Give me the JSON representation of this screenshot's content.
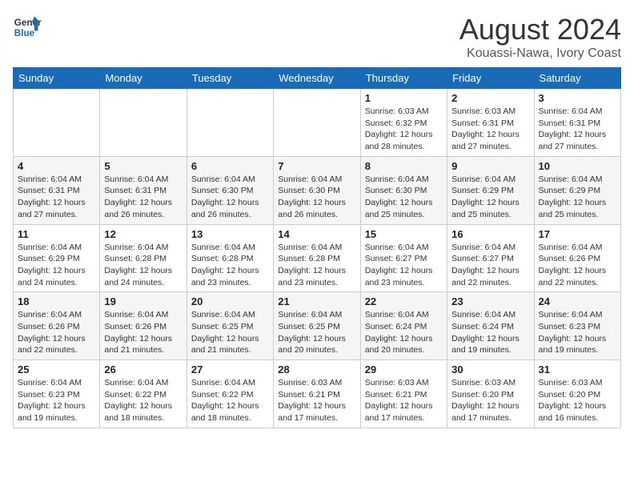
{
  "header": {
    "logo_line1": "General",
    "logo_line2": "Blue",
    "title": "August 2024",
    "subtitle": "Kouassi-Nawa, Ivory Coast"
  },
  "weekdays": [
    "Sunday",
    "Monday",
    "Tuesday",
    "Wednesday",
    "Thursday",
    "Friday",
    "Saturday"
  ],
  "weeks": [
    [
      {
        "day": "",
        "info": ""
      },
      {
        "day": "",
        "info": ""
      },
      {
        "day": "",
        "info": ""
      },
      {
        "day": "",
        "info": ""
      },
      {
        "day": "1",
        "info": "Sunrise: 6:03 AM\nSunset: 6:32 PM\nDaylight: 12 hours\nand 28 minutes."
      },
      {
        "day": "2",
        "info": "Sunrise: 6:03 AM\nSunset: 6:31 PM\nDaylight: 12 hours\nand 27 minutes."
      },
      {
        "day": "3",
        "info": "Sunrise: 6:04 AM\nSunset: 6:31 PM\nDaylight: 12 hours\nand 27 minutes."
      }
    ],
    [
      {
        "day": "4",
        "info": "Sunrise: 6:04 AM\nSunset: 6:31 PM\nDaylight: 12 hours\nand 27 minutes."
      },
      {
        "day": "5",
        "info": "Sunrise: 6:04 AM\nSunset: 6:31 PM\nDaylight: 12 hours\nand 26 minutes."
      },
      {
        "day": "6",
        "info": "Sunrise: 6:04 AM\nSunset: 6:30 PM\nDaylight: 12 hours\nand 26 minutes."
      },
      {
        "day": "7",
        "info": "Sunrise: 6:04 AM\nSunset: 6:30 PM\nDaylight: 12 hours\nand 26 minutes."
      },
      {
        "day": "8",
        "info": "Sunrise: 6:04 AM\nSunset: 6:30 PM\nDaylight: 12 hours\nand 25 minutes."
      },
      {
        "day": "9",
        "info": "Sunrise: 6:04 AM\nSunset: 6:29 PM\nDaylight: 12 hours\nand 25 minutes."
      },
      {
        "day": "10",
        "info": "Sunrise: 6:04 AM\nSunset: 6:29 PM\nDaylight: 12 hours\nand 25 minutes."
      }
    ],
    [
      {
        "day": "11",
        "info": "Sunrise: 6:04 AM\nSunset: 6:29 PM\nDaylight: 12 hours\nand 24 minutes."
      },
      {
        "day": "12",
        "info": "Sunrise: 6:04 AM\nSunset: 6:28 PM\nDaylight: 12 hours\nand 24 minutes."
      },
      {
        "day": "13",
        "info": "Sunrise: 6:04 AM\nSunset: 6:28 PM\nDaylight: 12 hours\nand 23 minutes."
      },
      {
        "day": "14",
        "info": "Sunrise: 6:04 AM\nSunset: 6:28 PM\nDaylight: 12 hours\nand 23 minutes."
      },
      {
        "day": "15",
        "info": "Sunrise: 6:04 AM\nSunset: 6:27 PM\nDaylight: 12 hours\nand 23 minutes."
      },
      {
        "day": "16",
        "info": "Sunrise: 6:04 AM\nSunset: 6:27 PM\nDaylight: 12 hours\nand 22 minutes."
      },
      {
        "day": "17",
        "info": "Sunrise: 6:04 AM\nSunset: 6:26 PM\nDaylight: 12 hours\nand 22 minutes."
      }
    ],
    [
      {
        "day": "18",
        "info": "Sunrise: 6:04 AM\nSunset: 6:26 PM\nDaylight: 12 hours\nand 22 minutes."
      },
      {
        "day": "19",
        "info": "Sunrise: 6:04 AM\nSunset: 6:26 PM\nDaylight: 12 hours\nand 21 minutes."
      },
      {
        "day": "20",
        "info": "Sunrise: 6:04 AM\nSunset: 6:25 PM\nDaylight: 12 hours\nand 21 minutes."
      },
      {
        "day": "21",
        "info": "Sunrise: 6:04 AM\nSunset: 6:25 PM\nDaylight: 12 hours\nand 20 minutes."
      },
      {
        "day": "22",
        "info": "Sunrise: 6:04 AM\nSunset: 6:24 PM\nDaylight: 12 hours\nand 20 minutes."
      },
      {
        "day": "23",
        "info": "Sunrise: 6:04 AM\nSunset: 6:24 PM\nDaylight: 12 hours\nand 19 minutes."
      },
      {
        "day": "24",
        "info": "Sunrise: 6:04 AM\nSunset: 6:23 PM\nDaylight: 12 hours\nand 19 minutes."
      }
    ],
    [
      {
        "day": "25",
        "info": "Sunrise: 6:04 AM\nSunset: 6:23 PM\nDaylight: 12 hours\nand 19 minutes."
      },
      {
        "day": "26",
        "info": "Sunrise: 6:04 AM\nSunset: 6:22 PM\nDaylight: 12 hours\nand 18 minutes."
      },
      {
        "day": "27",
        "info": "Sunrise: 6:04 AM\nSunset: 6:22 PM\nDaylight: 12 hours\nand 18 minutes."
      },
      {
        "day": "28",
        "info": "Sunrise: 6:03 AM\nSunset: 6:21 PM\nDaylight: 12 hours\nand 17 minutes."
      },
      {
        "day": "29",
        "info": "Sunrise: 6:03 AM\nSunset: 6:21 PM\nDaylight: 12 hours\nand 17 minutes."
      },
      {
        "day": "30",
        "info": "Sunrise: 6:03 AM\nSunset: 6:20 PM\nDaylight: 12 hours\nand 17 minutes."
      },
      {
        "day": "31",
        "info": "Sunrise: 6:03 AM\nSunset: 6:20 PM\nDaylight: 12 hours\nand 16 minutes."
      }
    ]
  ]
}
